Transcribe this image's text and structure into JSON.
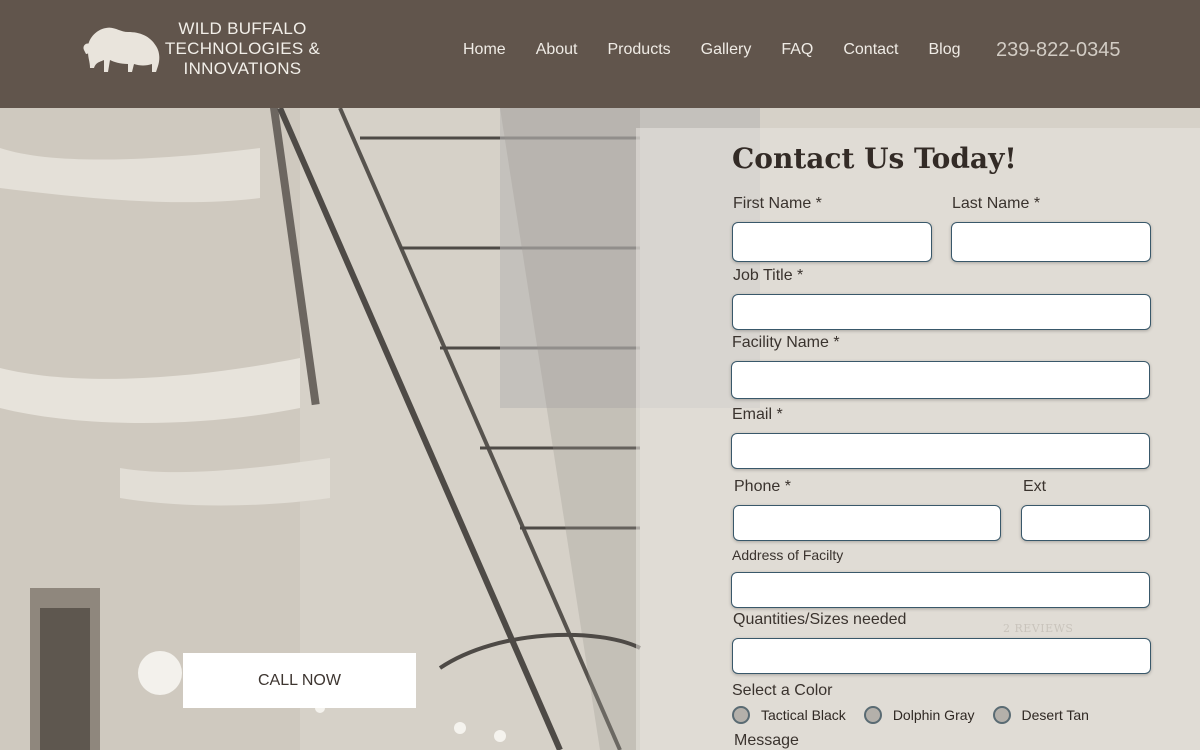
{
  "header": {
    "brand_line1": "WILD BUFFALO",
    "brand_line2": "TECHNOLOGIES &",
    "brand_line3": "INNOVATIONS",
    "logo_icon": "buffalo-icon",
    "nav": [
      "Home",
      "About",
      "Products",
      "Gallery",
      "FAQ",
      "Contact",
      "Blog"
    ],
    "phone": "239-822-0345"
  },
  "hero": {
    "call_button": "CALL NOW",
    "reviews_text": "2 REVIEWS"
  },
  "form": {
    "title": "Contact Us Today!",
    "first_name_label": "First Name *",
    "last_name_label": "Last Name *",
    "job_title_label": "Job Title *",
    "facility_name_label": "Facility Name *",
    "email_label": "Email *",
    "phone_label": "Phone *",
    "ext_label": "Ext",
    "address_label": "Address of Facilty",
    "quantities_label": "Quantities/Sizes needed",
    "color_label": "Select a Color",
    "colors": [
      "Tactical Black",
      "Dolphin Gray",
      "Desert Tan"
    ],
    "message_label": "Message"
  },
  "colors": {
    "header_bg": "#61554c",
    "input_border": "#39586a"
  }
}
